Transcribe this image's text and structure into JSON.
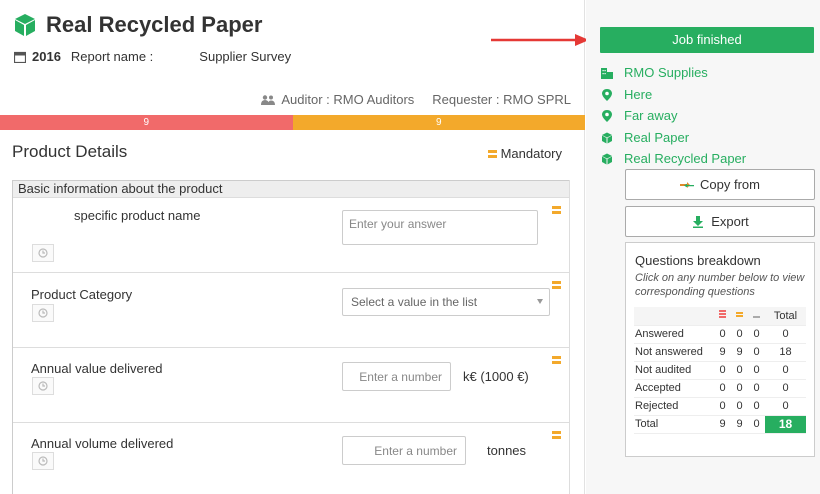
{
  "header": {
    "title": "Real Recycled Paper",
    "year": "2016",
    "report_label": "Report name :",
    "report_name": "Supplier Survey",
    "auditor": "Auditor : RMO Auditors",
    "requester": "Requester : RMO SPRL"
  },
  "progress": {
    "segments": [
      {
        "label": "9",
        "fraction": 0.5,
        "color": "#f16a6a"
      },
      {
        "label": "9",
        "fraction": 0.5,
        "color": "#f3a92b"
      }
    ]
  },
  "section": {
    "title": "Product Details",
    "mandatory_label": "Mandatory",
    "group_title": "Basic information about the product"
  },
  "questions": [
    {
      "label": "specific product name",
      "placeholder": "Enter your answer"
    },
    {
      "label": "Product Category",
      "placeholder": "Select a value in the list"
    },
    {
      "label": "Annual value delivered",
      "placeholder": "Enter a number",
      "unit": "k€ (1000 €)"
    },
    {
      "label": "Annual volume delivered",
      "placeholder": "Enter a number",
      "unit": "tonnes"
    }
  ],
  "sidebar": {
    "status": "Job finished",
    "links": [
      {
        "label": "RMO Supplies",
        "icon": "building-icon"
      },
      {
        "label": "Here",
        "icon": "map-pin-icon"
      },
      {
        "label": "Far away",
        "icon": "map-pin-icon"
      },
      {
        "label": "Real Paper",
        "icon": "cube-icon"
      },
      {
        "label": "Real Recycled Paper",
        "icon": "cube-icon"
      }
    ],
    "copy_from": "Copy from",
    "export": "Export"
  },
  "breakdown": {
    "title": "Questions breakdown",
    "hint": "Click on any number below to view corresponding questions",
    "total_header": "Total",
    "rows": [
      {
        "label": "Answered",
        "a": "0",
        "b": "0",
        "c": "0",
        "total": "0"
      },
      {
        "label": "Not answered",
        "a": "9",
        "b": "9",
        "c": "0",
        "total": "18"
      },
      {
        "label": "Not audited",
        "a": "0",
        "b": "0",
        "c": "0",
        "total": "0"
      },
      {
        "label": "Accepted",
        "a": "0",
        "b": "0",
        "c": "0",
        "total": "0"
      },
      {
        "label": "Rejected",
        "a": "0",
        "b": "0",
        "c": "0",
        "total": "0"
      },
      {
        "label": "Total",
        "a": "9",
        "b": "9",
        "c": "0",
        "total": "18"
      }
    ]
  },
  "colors": {
    "green": "#27ae60",
    "red": "#f16a6a",
    "orange": "#f3a92b",
    "arrow": "#e53935"
  }
}
